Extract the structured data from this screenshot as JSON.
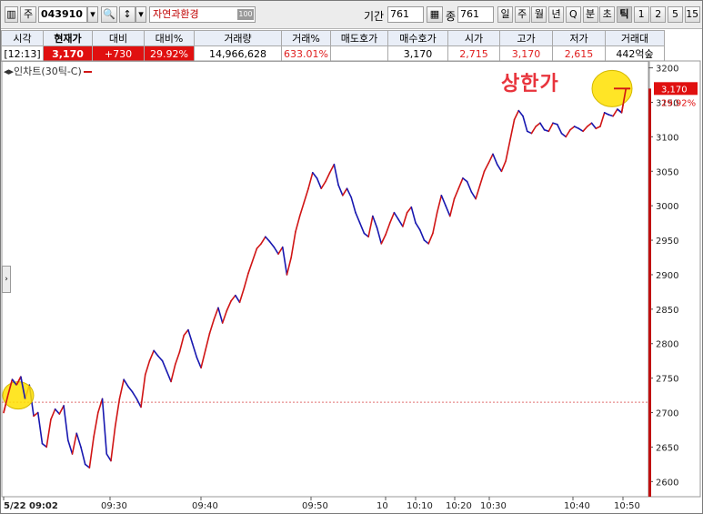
{
  "toolbar": {
    "stock_code": "043910",
    "stock_name": "자연과환경",
    "stock_number_badge": "100",
    "period_label": "기간",
    "period_value": "761",
    "count_label": "종",
    "count_value": "761",
    "periods": [
      "일",
      "주",
      "월",
      "년",
      "Q",
      "분",
      "초",
      "틱",
      "1",
      "2",
      "5",
      "15"
    ],
    "active_period": "틱"
  },
  "quote": {
    "headers": [
      "시각",
      "현재가",
      "대비",
      "대비%",
      "거래량",
      "거래%",
      "매도호가",
      "매수호가",
      "시가",
      "고가",
      "저가",
      "거래대"
    ],
    "values": [
      "[12:13]",
      "3,170",
      "+730",
      "29.92%",
      "14,966,628",
      "633.01%",
      "",
      "3,170",
      "2,715",
      "3,170",
      "2,615",
      "442억숲"
    ]
  },
  "indicator_label": "인차트(30틱-C)",
  "annotation": "상한가",
  "price_label": "3,170",
  "pct_label": "29.92%",
  "colors": {
    "up": "#d01515",
    "down": "#1818b0",
    "limit": "#e8343c",
    "highlight": "#ffe000"
  },
  "chart_data": {
    "type": "line",
    "title": "",
    "xlabel": "",
    "ylabel": "",
    "y_ticks": [
      3200,
      3150,
      3100,
      3050,
      3000,
      2950,
      2900,
      2850,
      2800,
      2750,
      2700,
      2650,
      2600
    ],
    "ylim": [
      2578,
      3210
    ],
    "x_ticks": [
      "5/22 09:02",
      "09:30",
      "09:40",
      "09:50",
      "10",
      "10:10",
      "10:20",
      "10:30",
      "10:40",
      "10:50"
    ],
    "reference_price": 2715,
    "last_price": 3170,
    "series": [
      {
        "values": [
          2700,
          2725,
          2748,
          2740,
          2752,
          2720,
          2740,
          2695,
          2700,
          2655,
          2650,
          2690,
          2705,
          2698,
          2710,
          2660,
          2640,
          2670,
          2650,
          2625,
          2620,
          2665,
          2700,
          2720,
          2640,
          2630,
          2680,
          2720,
          2748,
          2738,
          2730,
          2720,
          2708,
          2755,
          2775,
          2790,
          2782,
          2775,
          2760,
          2745,
          2770,
          2788,
          2812,
          2820,
          2800,
          2780,
          2765,
          2790,
          2815,
          2835,
          2852,
          2830,
          2848,
          2862,
          2870,
          2860,
          2880,
          2902,
          2920,
          2938,
          2945,
          2955,
          2948,
          2940,
          2930,
          2940,
          2900,
          2925,
          2962,
          2985,
          3005,
          3025,
          3048,
          3040,
          3025,
          3035,
          3048,
          3060,
          3030,
          3015,
          3025,
          3012,
          2990,
          2975,
          2960,
          2955,
          2985,
          2968,
          2945,
          2958,
          2975,
          2990,
          2980,
          2970,
          2990,
          2998,
          2975,
          2965,
          2950,
          2945,
          2960,
          2990,
          3015,
          3000,
          2985,
          3010,
          3025,
          3040,
          3035,
          3020,
          3010,
          3030,
          3050,
          3062,
          3075,
          3060,
          3050,
          3065,
          3095,
          3125,
          3138,
          3130,
          3108,
          3105,
          3115,
          3120,
          3110,
          3108,
          3120,
          3118,
          3105,
          3100,
          3110,
          3115,
          3112,
          3108,
          3115,
          3120,
          3112,
          3115,
          3135,
          3132,
          3130,
          3140,
          3135,
          3170,
          3170
        ]
      }
    ]
  }
}
